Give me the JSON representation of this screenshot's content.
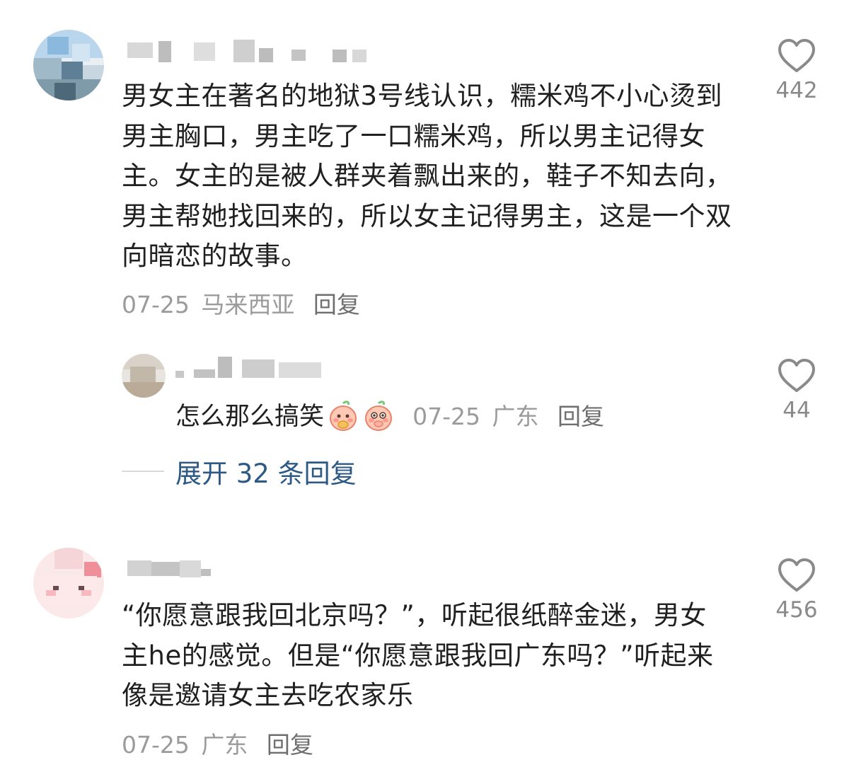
{
  "comments": [
    {
      "text": "男女主在著名的地狱3号线认识，糯米鸡不小心烫到男主胸口，男主吃了一口糯米鸡，所以男主记得女主。女主的是被人群夹着飘出来的，鞋子不知去向，男主帮她找回来的，所以女主记得男主，这是一个双向暗恋的故事。",
      "date": "07-25",
      "location": "马来西亚",
      "reply_label": "回复",
      "likes": "442",
      "replies": [
        {
          "text": "怎么那么搞笑",
          "emojis": [
            "peach-eating-emoji",
            "peach-shy-emoji"
          ],
          "date": "07-25",
          "location": "广东",
          "reply_label": "回复",
          "likes": "44"
        }
      ],
      "expand_label": "展开 32 条回复"
    },
    {
      "text": "“你愿意跟我回北京吗？”，听起很纸醉金迷，男女主he的感觉。但是“你愿意跟我回广东吗？”听起来像是邀请女主去吃农家乐",
      "date": "07-25",
      "location": "广东",
      "reply_label": "回复",
      "likes": "456"
    }
  ],
  "icons": {
    "like": "heart-outline-icon"
  },
  "colors": {
    "text": "#202020",
    "meta": "#9b9b9b",
    "link": "#2c5a85",
    "icon": "#8a8a8a"
  }
}
